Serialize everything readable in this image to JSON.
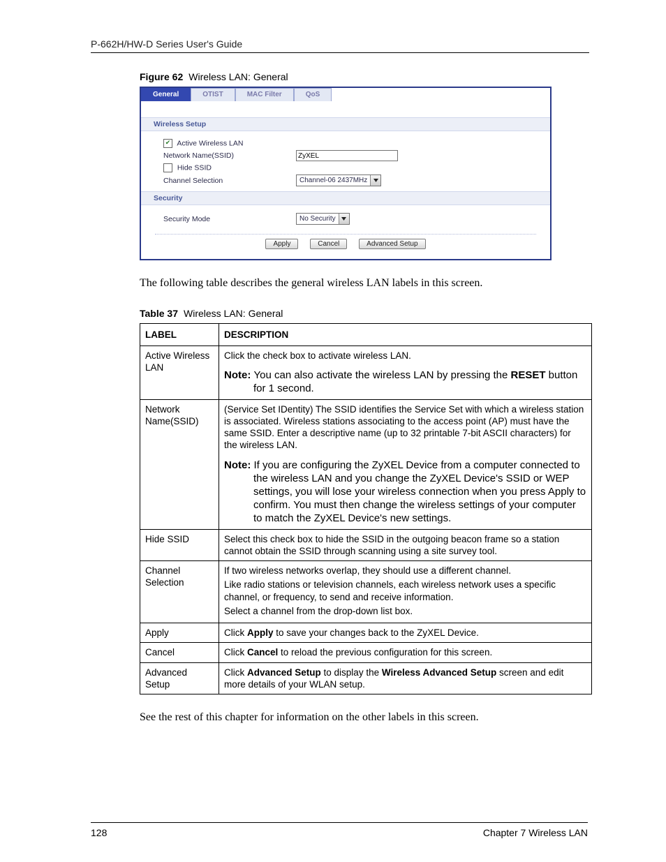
{
  "header": {
    "running": "P-662H/HW-D Series User's Guide"
  },
  "figure": {
    "label": "Figure 62",
    "title": "Wireless LAN: General"
  },
  "panel": {
    "tabs": [
      "General",
      "OTIST",
      "MAC Filter",
      "QoS"
    ],
    "section1": "Wireless Setup",
    "active_wlan": {
      "label": "Active Wireless LAN",
      "checked": "✔"
    },
    "ssid": {
      "label": "Network Name(SSID)",
      "value": "ZyXEL"
    },
    "hide_ssid": {
      "label": "Hide SSID"
    },
    "channel": {
      "label": "Channel Selection",
      "value": "Channel-06 2437MHz"
    },
    "section2": "Security",
    "sec_mode": {
      "label": "Security Mode",
      "value": "No Security"
    },
    "buttons": {
      "apply": "Apply",
      "cancel": "Cancel",
      "adv": "Advanced Setup"
    }
  },
  "intro_para": "The following table describes the general wireless LAN labels in this screen.",
  "table": {
    "label": "Table 37",
    "title": "Wireless LAN: General",
    "head": {
      "c1": "LABEL",
      "c2": "DESCRIPTION"
    },
    "rows": {
      "r1": {
        "label": "Active Wireless LAN",
        "desc": "Click the check box to activate wireless LAN.",
        "note_lead": "Note: ",
        "note_a": "You can also activate the wireless LAN by pressing the ",
        "note_bold": "RESET",
        "note_b": " button for 1 second."
      },
      "r2": {
        "label": "Network Name(SSID)",
        "desc": "(Service Set IDentity) The SSID identifies the Service Set with which a wireless station is associated. Wireless stations associating to the access point (AP) must have the same SSID. Enter a descriptive name (up to 32 printable 7-bit ASCII characters) for the wireless LAN.",
        "note_lead": "Note: ",
        "note": "If you are configuring the ZyXEL Device from a computer connected to the wireless LAN and you change the ZyXEL Device's SSID or WEP settings, you will lose your wireless connection when you press Apply to confirm. You must then change the wireless settings of your computer to match the ZyXEL Device's new settings."
      },
      "r3": {
        "label": "Hide SSID",
        "desc": "Select this check box to hide the SSID in the outgoing beacon frame so a station cannot obtain the SSID through scanning using a site survey tool."
      },
      "r4": {
        "label": "Channel Selection",
        "p1": "If two wireless networks overlap, they should use a different channel.",
        "p2": "Like radio stations or television channels, each wireless network uses a specific channel, or frequency, to send and receive information.",
        "p3": "Select a channel from the drop-down list box."
      },
      "r5": {
        "label": "Apply",
        "pre": "Click ",
        "bold": "Apply",
        "post": " to save your changes back to the ZyXEL Device."
      },
      "r6": {
        "label": "Cancel",
        "pre": "Click ",
        "bold": "Cancel",
        "post": " to reload the previous configuration for this screen."
      },
      "r7": {
        "label": "Advanced Setup",
        "pre": "Click ",
        "bold1": "Advanced Setup",
        "mid": " to display the ",
        "bold2": "Wireless Advanced Setup",
        "post": " screen and edit more details of your WLAN setup."
      }
    }
  },
  "outro_para": "See the rest of this chapter for information on the other labels in this screen.",
  "footer": {
    "page": "128",
    "chapter": "Chapter 7 Wireless LAN"
  }
}
